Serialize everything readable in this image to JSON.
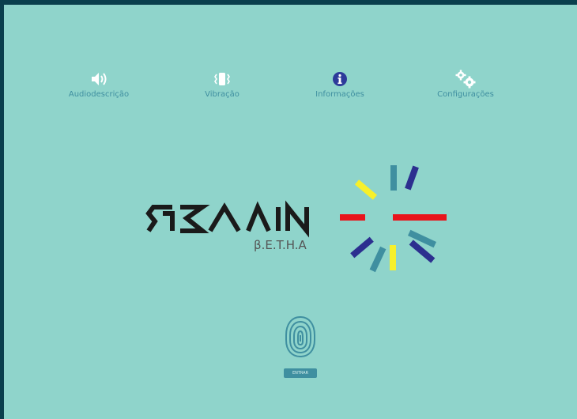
{
  "toolbar": {
    "items": [
      {
        "label": "Audiodescrição",
        "icon": "speaker-icon"
      },
      {
        "label": "Vibração",
        "icon": "vibration-icon"
      },
      {
        "label": "Informações",
        "icon": "info-icon"
      },
      {
        "label": "Configurações",
        "icon": "gears-icon"
      }
    ]
  },
  "logo": {
    "wordmark": "GRAIN",
    "subtitle": "β.E.T.H.A"
  },
  "login": {
    "button_label": "ENTRAR",
    "icon": "fingerprint-icon"
  },
  "colors": {
    "background": "#8fd4cb",
    "accent_teal": "#3f8fa0",
    "info_blue": "#2d3a9a",
    "logo_red": "#e8141c",
    "logo_yellow": "#f7f02a",
    "logo_navy": "#2c2f8f",
    "logo_steel": "#3f8fa0"
  }
}
